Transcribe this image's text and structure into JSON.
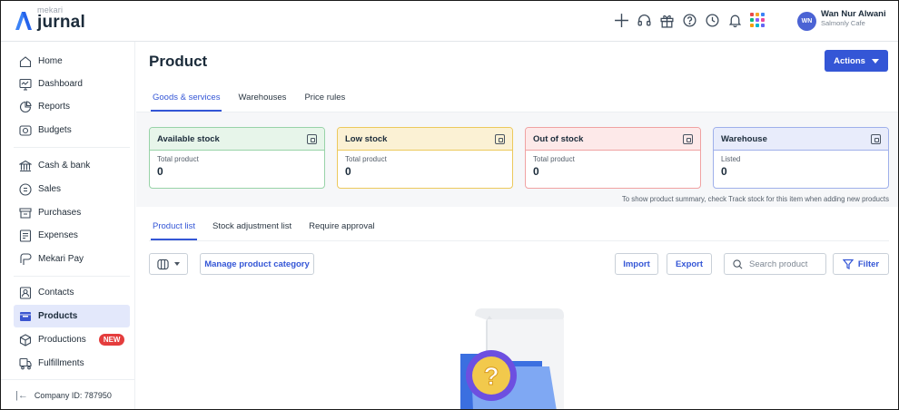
{
  "brand": {
    "small": "mekari",
    "name": "jurnal"
  },
  "header": {
    "icons": [
      "plus-icon",
      "headset-icon",
      "gift-icon",
      "help-icon",
      "clock-icon",
      "bell-icon",
      "apps-grid-icon"
    ],
    "avatar_initials": "WN",
    "user_name": "Wan Nur Alwani",
    "company": "Salmonly Cafe"
  },
  "sidebar": {
    "items": [
      {
        "label": "Home",
        "icon": "home-icon"
      },
      {
        "label": "Dashboard",
        "icon": "dashboard-icon"
      },
      {
        "label": "Reports",
        "icon": "reports-icon"
      },
      {
        "label": "Budgets",
        "icon": "budgets-icon"
      },
      {
        "label": "Cash & bank",
        "icon": "bank-icon"
      },
      {
        "label": "Sales",
        "icon": "sales-icon"
      },
      {
        "label": "Purchases",
        "icon": "purchases-icon"
      },
      {
        "label": "Expenses",
        "icon": "expenses-icon"
      },
      {
        "label": "Mekari Pay",
        "icon": "mekari-pay-icon"
      },
      {
        "label": "Contacts",
        "icon": "contacts-icon"
      },
      {
        "label": "Products",
        "icon": "products-icon",
        "active": true
      },
      {
        "label": "Productions",
        "icon": "productions-icon",
        "badge": "NEW"
      },
      {
        "label": "Fulfillments",
        "icon": "fulfillments-icon"
      }
    ],
    "company_id": "Company ID: 787950"
  },
  "page": {
    "title": "Product",
    "actions_label": "Actions",
    "tabs": [
      "Goods & services",
      "Warehouses",
      "Price rules"
    ],
    "active_tab": "Goods & services"
  },
  "stock_cards": [
    {
      "title": "Available stock",
      "sub": "Total product",
      "value": "0",
      "color": "#98d3a8"
    },
    {
      "title": "Low stock",
      "sub": "Total product",
      "value": "0",
      "color": "#ecc95c"
    },
    {
      "title": "Out of stock",
      "sub": "Total product",
      "value": "0",
      "color": "#f0a2a2"
    },
    {
      "title": "Warehouse",
      "sub": "Listed",
      "value": "0",
      "color": "#9fb0ea"
    }
  ],
  "stock_note": "To show product summary, check Track stock for this item when adding new products",
  "list": {
    "subtabs": [
      "Product list",
      "Stock adjustment list",
      "Require approval"
    ],
    "active_subtab": "Product list",
    "manage_category_label": "Manage product category",
    "import_label": "Import",
    "export_label": "Export",
    "search_placeholder": "Search product",
    "filter_label": "Filter"
  },
  "colors": {
    "accent": "#3456d6",
    "badge_red": "#e43d3d",
    "active_bg": "#e3e8fb"
  }
}
